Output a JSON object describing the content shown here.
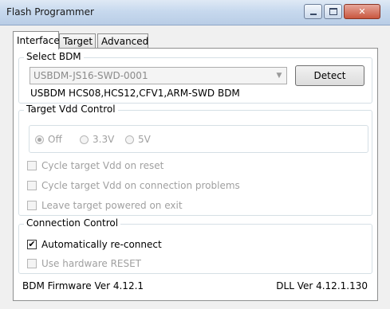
{
  "window": {
    "title": "Flash Programmer",
    "close_glyph": "✕"
  },
  "tabs": [
    {
      "label": "Interface",
      "active": true
    },
    {
      "label": "Target",
      "active": false
    },
    {
      "label": "Advanced",
      "active": false
    }
  ],
  "select_bdm": {
    "legend": "Select BDM",
    "combo_value": "USBDM-JS16-SWD-0001",
    "combo_arrow": "▼",
    "detect_label": "Detect",
    "description": "USBDM HCS08,HCS12,CFV1,ARM-SWD BDM"
  },
  "target_vdd": {
    "legend": "Target Vdd Control",
    "radios": [
      {
        "label": "Off",
        "selected": true
      },
      {
        "label": "3.3V",
        "selected": false
      },
      {
        "label": "5V",
        "selected": false
      }
    ],
    "checkboxes": [
      {
        "label": "Cycle target Vdd on reset",
        "checked": false
      },
      {
        "label": "Cycle target Vdd on connection problems",
        "checked": false
      },
      {
        "label": "Leave target powered on exit",
        "checked": false
      }
    ]
  },
  "connection": {
    "legend": "Connection Control",
    "checkboxes": [
      {
        "label": "Automatically re-connect",
        "checked": true,
        "check_glyph": "✔"
      },
      {
        "label": "Use hardware RESET",
        "checked": false
      }
    ]
  },
  "footer": {
    "firmware": "BDM Firmware Ver 4.12.1",
    "dll": "DLL Ver 4.12.1.130"
  }
}
